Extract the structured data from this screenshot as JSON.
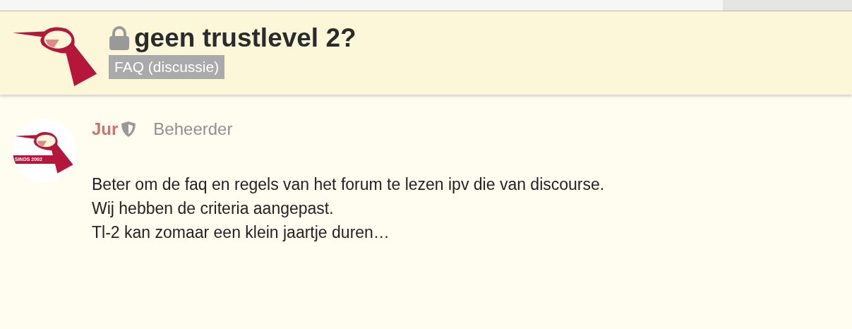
{
  "topic": {
    "title": "geen trustlevel 2?",
    "locked": true,
    "category": "FAQ (discussie)"
  },
  "post": {
    "author": "Jur",
    "moderator": true,
    "role": "Beheerder",
    "avatar_text": "SINDS 2002",
    "lines": [
      "Beter om de faq en regels van het forum te lezen ipv die van discourse.",
      "Wij hebben de criteria aangepast.",
      "Tl-2 kan zomaar een klein jaartje duren…"
    ]
  }
}
